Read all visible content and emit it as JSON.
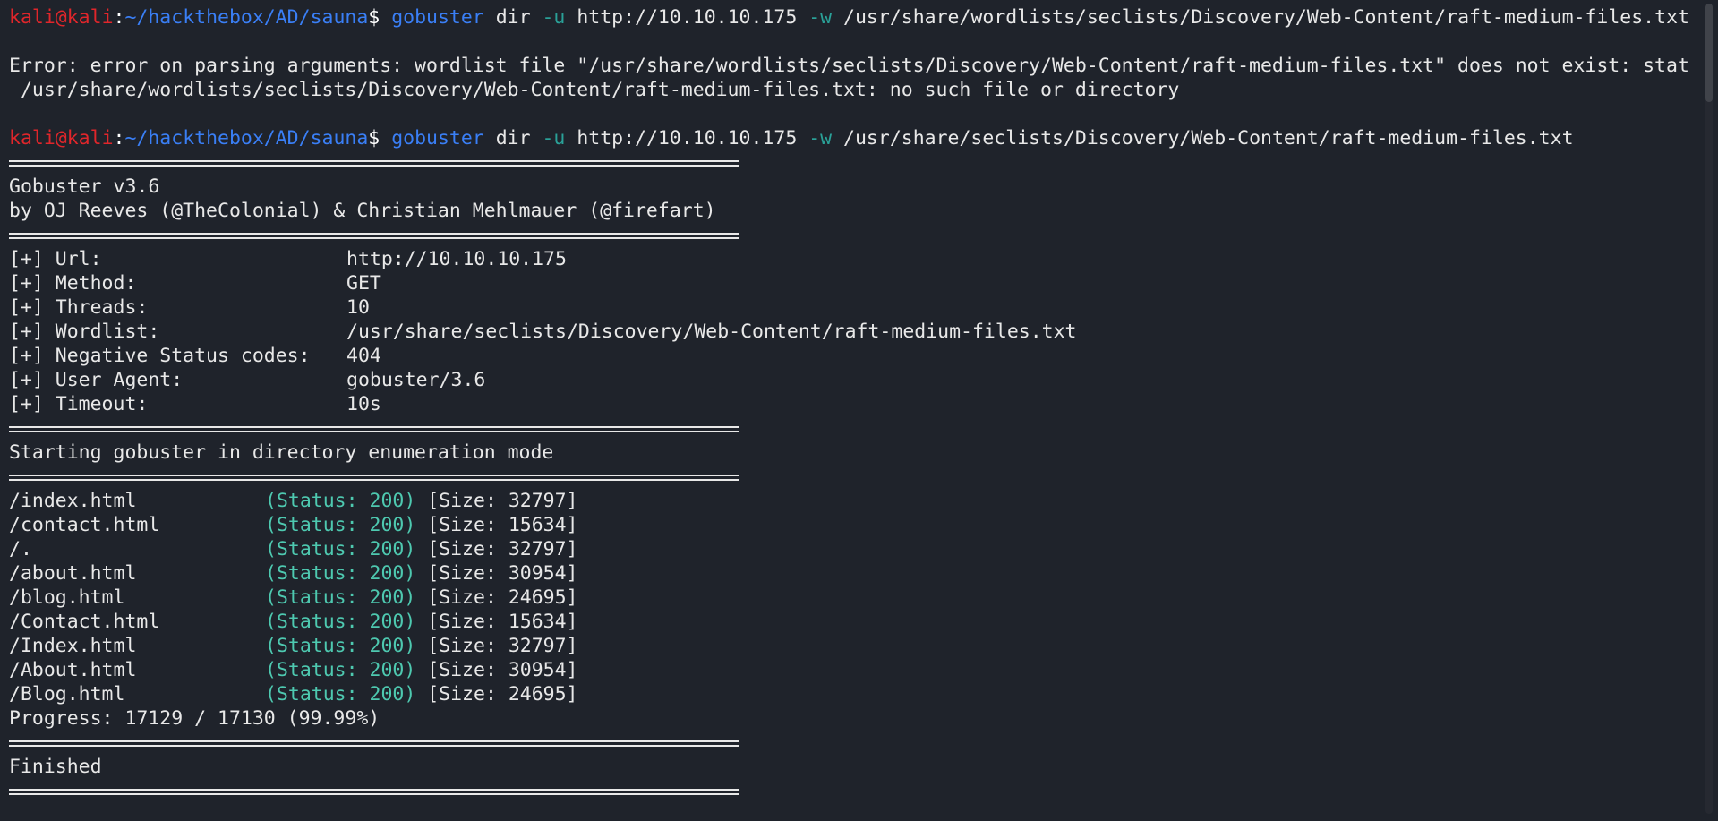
{
  "prompt": {
    "user": "kali",
    "at": "@",
    "host": "kali",
    "colon": ":",
    "path": "~/hackthebox/AD/sauna",
    "dollar": "$ "
  },
  "command1": {
    "tool": "gobuster",
    "sub": " dir ",
    "flag_u": "-u",
    "url": " http://10.10.10.175 ",
    "flag_w": "-w",
    "wordlist": " /usr/share/wordlists/seclists/Discovery/Web-Content/raft-medium-files.txt"
  },
  "error": {
    "line1": "Error: error on parsing arguments: wordlist file \"/usr/share/wordlists/seclists/Discovery/Web-Content/raft-medium-files.txt\" does not exist: stat",
    "line2": " /usr/share/wordlists/seclists/Discovery/Web-Content/raft-medium-files.txt: no such file or directory"
  },
  "command2": {
    "tool": "gobuster",
    "sub": " dir ",
    "flag_u": "-u",
    "url": " http://10.10.10.175 ",
    "flag_w": "-w",
    "wordlist": " /usr/share/seclists/Discovery/Web-Content/raft-medium-files.txt"
  },
  "banner": {
    "version": "Gobuster v3.6",
    "authors": "by OJ Reeves (@TheColonial) & Christian Mehlmauer (@firefart)"
  },
  "config": [
    {
      "label": "[+] Url:",
      "value": "http://10.10.10.175"
    },
    {
      "label": "[+] Method:",
      "value": "GET"
    },
    {
      "label": "[+] Threads:",
      "value": "10"
    },
    {
      "label": "[+] Wordlist:",
      "value": "/usr/share/seclists/Discovery/Web-Content/raft-medium-files.txt"
    },
    {
      "label": "[+] Negative Status codes:",
      "value": "404"
    },
    {
      "label": "[+] User Agent:",
      "value": "gobuster/3.6"
    },
    {
      "label": "[+] Timeout:",
      "value": "10s"
    }
  ],
  "mode_text": "Starting gobuster in directory enumeration mode",
  "results": [
    {
      "path": "/index.html",
      "status": "(Status: 200)",
      "size": " [Size: 32797]"
    },
    {
      "path": "/contact.html",
      "status": "(Status: 200)",
      "size": " [Size: 15634]"
    },
    {
      "path": "/.",
      "status": "(Status: 200)",
      "size": " [Size: 32797]"
    },
    {
      "path": "/about.html",
      "status": "(Status: 200)",
      "size": " [Size: 30954]"
    },
    {
      "path": "/blog.html",
      "status": "(Status: 200)",
      "size": " [Size: 24695]"
    },
    {
      "path": "/Contact.html",
      "status": "(Status: 200)",
      "size": " [Size: 15634]"
    },
    {
      "path": "/Index.html",
      "status": "(Status: 200)",
      "size": " [Size: 32797]"
    },
    {
      "path": "/About.html",
      "status": "(Status: 200)",
      "size": " [Size: 30954]"
    },
    {
      "path": "/Blog.html",
      "status": "(Status: 200)",
      "size": " [Size: 24695]"
    }
  ],
  "progress": "Progress: 17129 / 17130 (99.99%)",
  "finished": "Finished",
  "colors": {
    "background": "#1f232b",
    "prompt_user": "#e0262b",
    "prompt_path": "#3a7ff6",
    "status_ok": "#4ec9b0"
  }
}
